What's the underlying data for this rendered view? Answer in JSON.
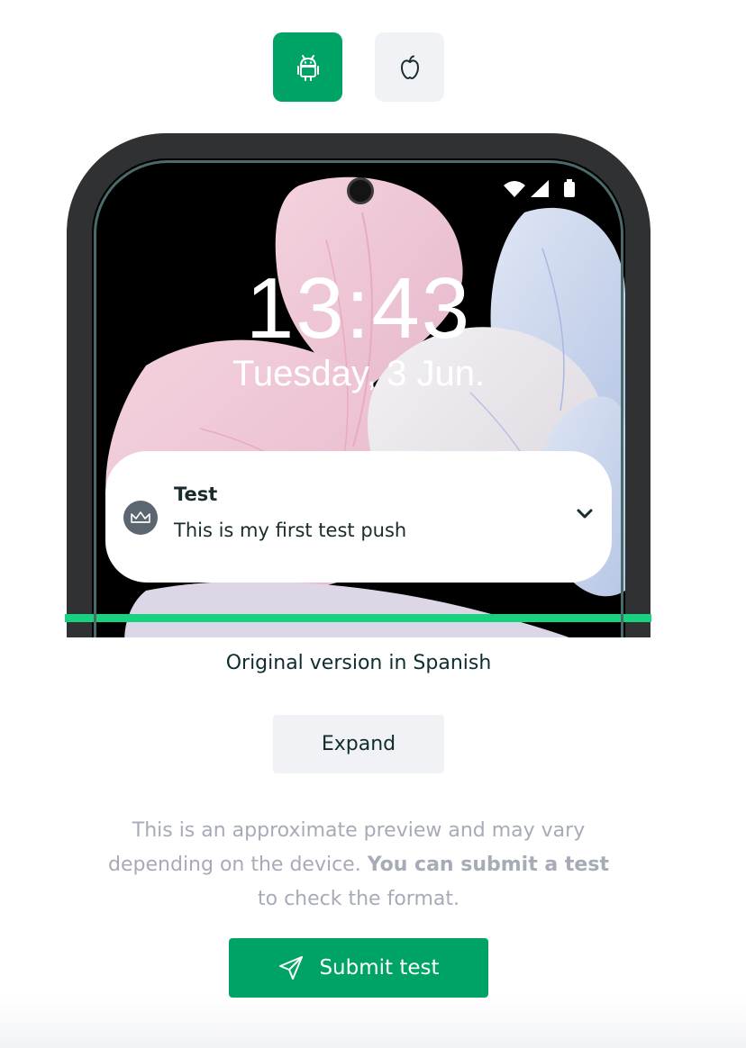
{
  "platforms": [
    {
      "name": "android",
      "icon": "android-icon",
      "selected": true
    },
    {
      "name": "ios",
      "icon": "apple-icon",
      "selected": false
    }
  ],
  "lockscreen": {
    "time": "13:43",
    "date": "Tuesday, 3 Jun."
  },
  "notification": {
    "title": "Test",
    "body": "This is my first test push",
    "app_icon": "crown-icon",
    "expand_icon": "chevron-down-icon"
  },
  "version_label": "Original version in Spanish",
  "expand_label": "Expand",
  "disclaimer": {
    "text_before": "This is an approximate preview and may vary depending on the device. ",
    "bold_text": "You can submit a test",
    "text_after": " to check the format."
  },
  "submit": {
    "label": "Submit test",
    "icon": "send-icon"
  },
  "colors": {
    "primary": "#00a366",
    "accent_bar": "#19d27f",
    "muted_text": "#a7abb8",
    "secondary_button": "#f0f2f5"
  }
}
